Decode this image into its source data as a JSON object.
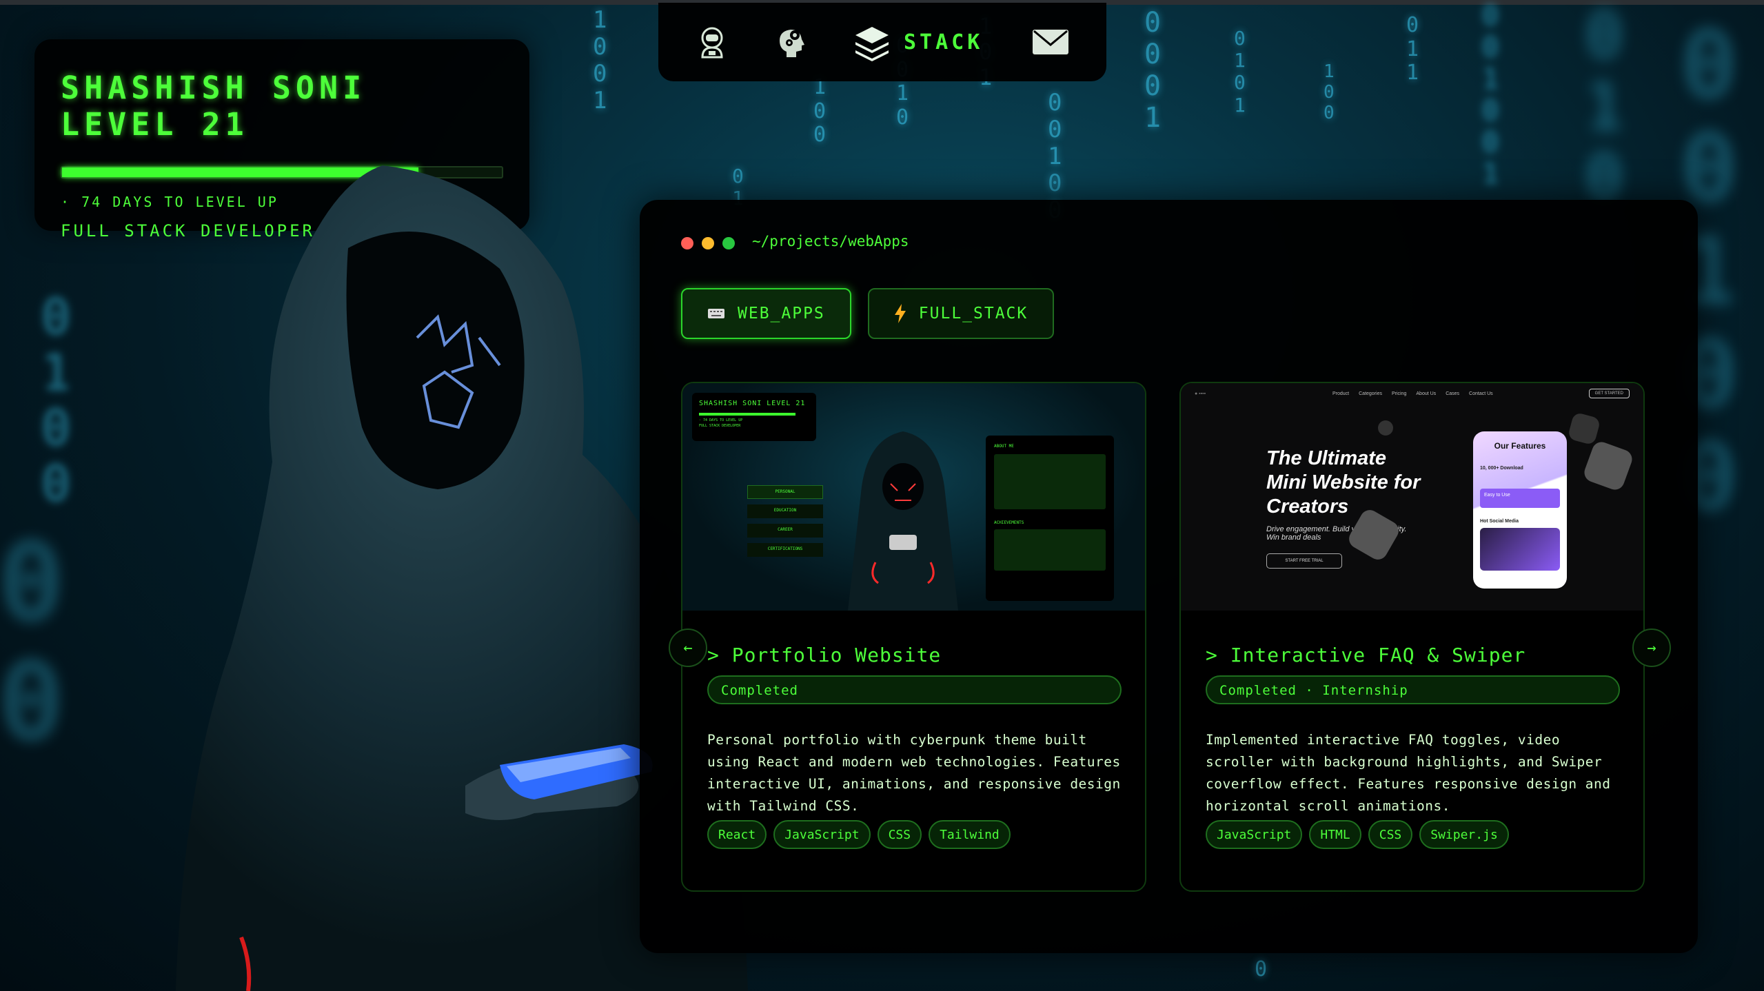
{
  "level_card": {
    "title": "SHASHISH SONI LEVEL 21",
    "xp_progress": 0.81,
    "days_to_level": "· 74 DAYS TO LEVEL UP",
    "role": "FULL STACK DEVELOPER"
  },
  "nav": {
    "items": [
      {
        "icon": "astronaut-icon"
      },
      {
        "icon": "gears-head-icon"
      },
      {
        "icon": "layers-icon",
        "label": "STACK"
      },
      {
        "icon": "envelope-icon"
      }
    ]
  },
  "panel": {
    "path": "~/projects/webApps",
    "window_dots": [
      "#ff5f57",
      "#febc2e",
      "#28c840"
    ],
    "tabs": [
      {
        "icon": "keyboard-icon",
        "label": "WEB_APPS"
      },
      {
        "icon": "lightning-icon",
        "label": "FULL_STACK"
      }
    ],
    "projects": [
      {
        "title": "> Portfolio Website",
        "status": "Completed",
        "description": "Personal portfolio with cyberpunk theme built using React and modern web technologies. Features interactive UI, animations, and responsive design with Tailwind CSS.",
        "tags": [
          "React",
          "JavaScript",
          "CSS",
          "Tailwind"
        ],
        "thumb": {
          "title": "SHASHISH SONI LEVEL 21",
          "sub": "· 74 DAYS TO LEVEL UP",
          "role": "FULL STACK DEVELOPER",
          "menu": [
            "PERSONAL",
            "EDUCATION",
            "CAREER",
            "CERTIFICATIONS"
          ],
          "about": "ABOUT ME",
          "achievements": "ACHIEVEMENTS"
        }
      },
      {
        "title": "> Interactive FAQ & Swiper",
        "status": "Completed · Internship",
        "description": "Implemented interactive FAQ toggles, video scroller with background highlights, and Swiper coverflow effect. Features responsive design and horizontal scroll animations.",
        "tags": [
          "JavaScript",
          "HTML",
          "CSS",
          "Swiper.js"
        ],
        "thumb": {
          "nav": [
            "Product",
            "Categories",
            "Pricing",
            "About Us",
            "Cases",
            "Contact Us"
          ],
          "cta": "GET STARTED",
          "headline": "The Ultimate Mini Website for Creators",
          "sub": "Drive engagement. Build your community. Win brand deals",
          "button": "START FREE TRIAL",
          "phone_title": "Our Features",
          "phone_items": [
            "10, 000+ Download",
            "Easy to Use",
            "Hot Social Media"
          ]
        }
      }
    ],
    "prev_label": "←",
    "next_label": "→"
  },
  "colors": {
    "accent": "#4dff3a",
    "panel_bg": "#000000",
    "matrix": "#3fd6ff"
  }
}
